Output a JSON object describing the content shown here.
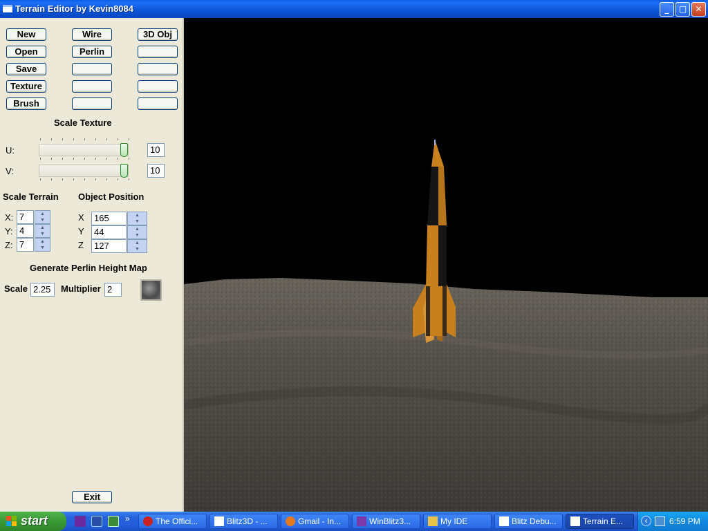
{
  "window": {
    "title": "Terrain Editor by Kevin8084",
    "controls": {
      "minimize": "_",
      "maximize": "□",
      "close": "✕"
    }
  },
  "buttons": {
    "col1": [
      "New",
      "Open",
      "Save",
      "Texture",
      "Brush"
    ],
    "col2": [
      "Wire",
      "Perlin",
      "",
      "",
      ""
    ],
    "col3": [
      "3D Obj",
      "",
      "",
      "",
      ""
    ]
  },
  "scale_texture": {
    "heading": "Scale Texture",
    "u_label": "U:",
    "u_value": "10",
    "u_slider_fraction": 1.0,
    "v_label": "V:",
    "v_value": "10",
    "v_slider_fraction": 1.0
  },
  "scale_terrain": {
    "heading": "Scale Terrain",
    "x_label": "X:",
    "x_value": "7",
    "y_label": "Y:",
    "y_value": "4",
    "z_label": "Z:",
    "z_value": "7"
  },
  "object_position": {
    "heading": "Object Position",
    "x_label": "X",
    "x_value": "165",
    "y_label": "Y",
    "y_value": "44",
    "z_label": "Z",
    "z_value": "127"
  },
  "perlin": {
    "heading": "Generate Perlin Height Map",
    "scale_label": "Scale",
    "scale_value": "2.25",
    "multiplier_label": "Multiplier",
    "multiplier_value": "2"
  },
  "exit_label": "Exit",
  "taskbar": {
    "start_label": "start",
    "overflow": "»",
    "tasks": [
      "The Offici...",
      "Blitz3D - ...",
      "Gmail - In...",
      "WinBlitz3...",
      "My IDE",
      "Blitz Debu...",
      "Terrain E..."
    ],
    "active_task": "Terrain E...",
    "tray_chevron": "‹",
    "clock": "6:59 PM"
  },
  "colors": {
    "panel_bg": "#ece9d8",
    "titlebar": "#0c56d8",
    "rocket_body": "#c8801e",
    "ground": "#4a4741"
  }
}
